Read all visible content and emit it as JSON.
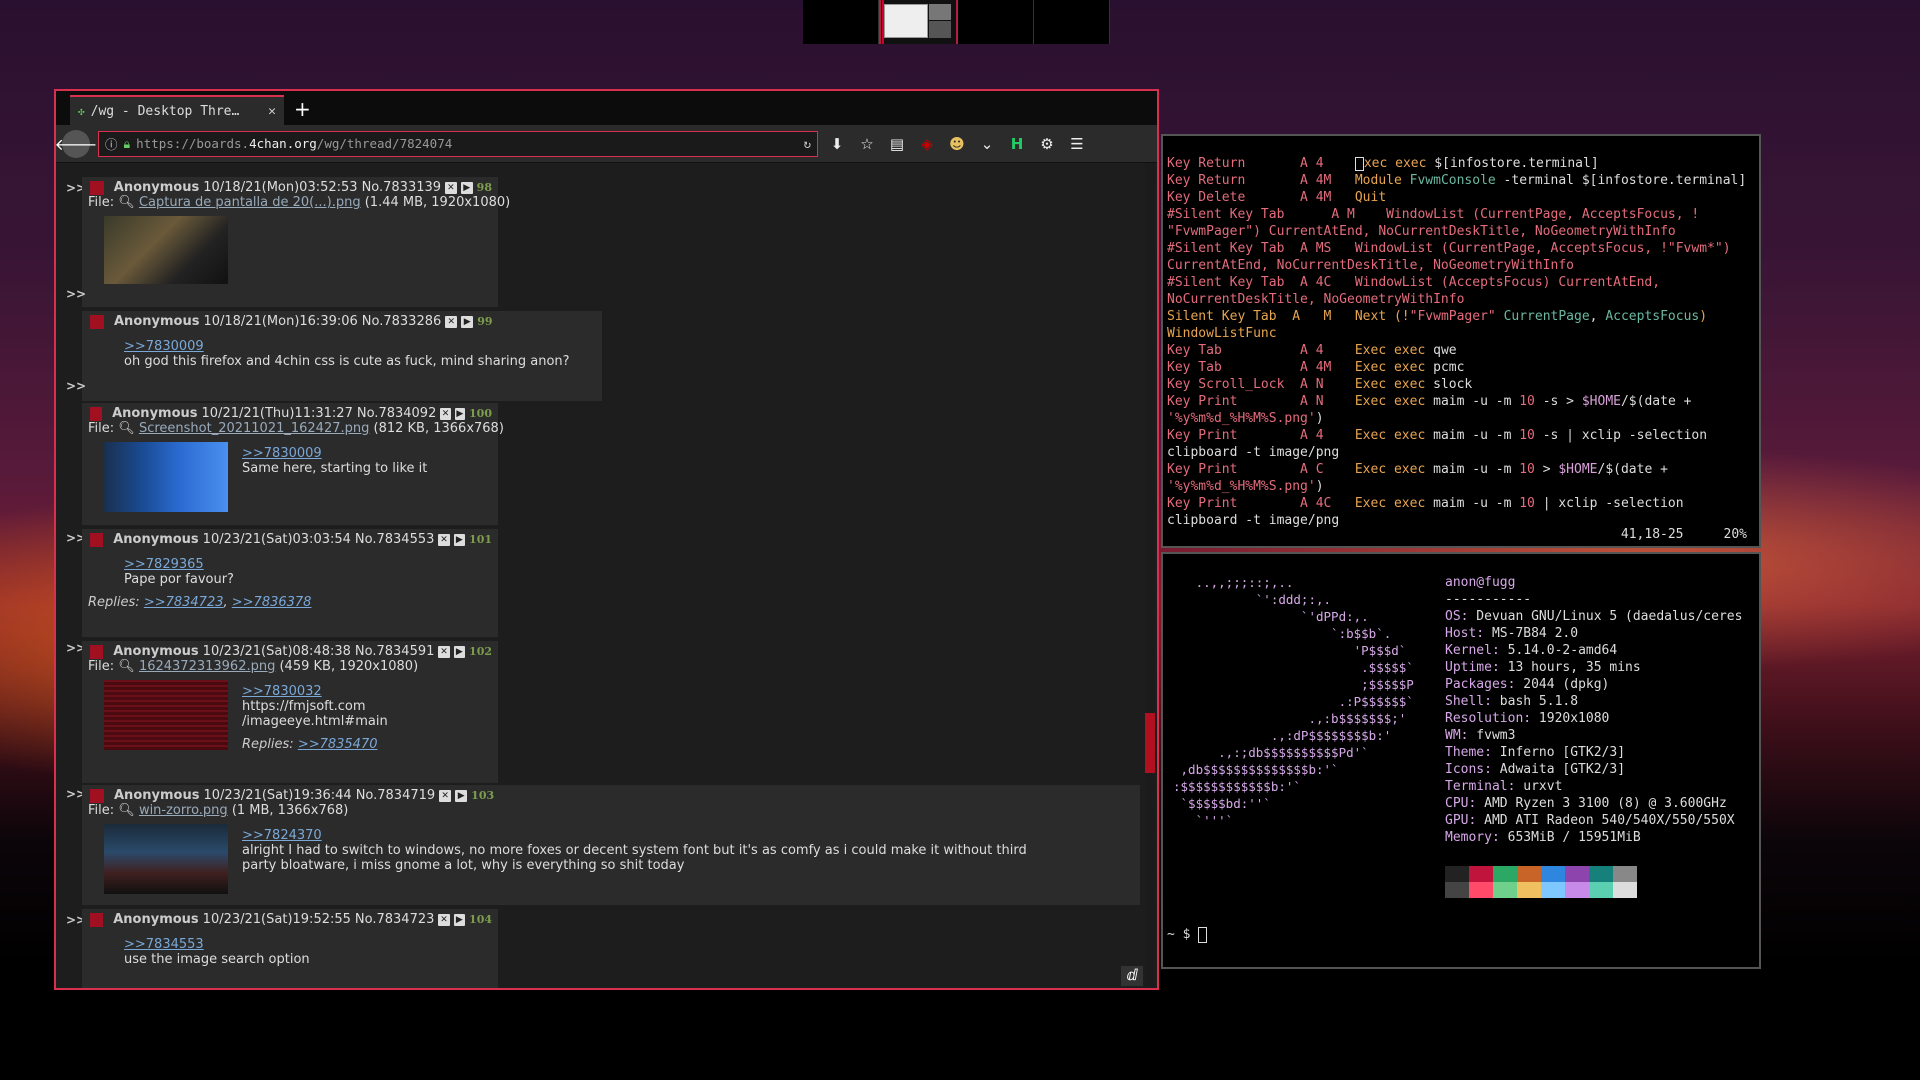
{
  "pager": {
    "desks": 4,
    "active": 1
  },
  "browser": {
    "tab_title": "/wg - Desktop Thre…",
    "url_prefix": "https://boards.",
    "url_host": "4chan.org",
    "url_path": "/wg/thread/7824074",
    "posts": [
      {
        "name": "Anonymous",
        "date": "10/18/21(Mon)03:52:53",
        "no": "No.7833139",
        "reply_num": "98",
        "file_label": "File:",
        "file_name": "Captura de pantalla de 20(...).png",
        "file_info": "(1.44 MB, 1920x1080)",
        "quote": "",
        "text": "",
        "replies": ""
      },
      {
        "name": "Anonymous",
        "date": "10/18/21(Mon)16:39:06",
        "no": "No.7833286",
        "reply_num": "99",
        "file_label": "",
        "file_name": "",
        "file_info": "",
        "quote": ">>7830009",
        "text": "oh god this firefox and 4chin css is cute as fuck, mind sharing anon?",
        "replies": ""
      },
      {
        "name": "Anonymous",
        "date": "10/21/21(Thu)11:31:27",
        "no": "No.7834092",
        "reply_num": "100",
        "file_label": "File:",
        "file_name": "Screenshot_20211021_162427.png",
        "file_info": "(812 KB, 1366x768)",
        "quote": ">>7830009",
        "text": "Same here, starting to like it",
        "replies": ""
      },
      {
        "name": "Anonymous",
        "date": "10/23/21(Sat)03:03:54",
        "no": "No.7834553",
        "reply_num": "101",
        "file_label": "",
        "file_name": "",
        "file_info": "",
        "quote": ">>7829365",
        "text": "Pape por favour?",
        "replies_label": "Replies:",
        "replies_a": ">>7834723",
        "replies_b": ">>7836378"
      },
      {
        "name": "Anonymous",
        "date": "10/23/21(Sat)08:48:38",
        "no": "No.7834591",
        "reply_num": "102",
        "file_label": "File:",
        "file_name": "1624372313962.png",
        "file_info": "(459 KB, 1920x1080)",
        "quote": ">>7830032",
        "text": "https://fmjsoft.com /imageeye.html#main",
        "replies_label": "Replies:",
        "replies_a": ">>7835470"
      },
      {
        "name": "Anonymous",
        "date": "10/23/21(Sat)19:36:44",
        "no": "No.7834719",
        "reply_num": "103",
        "file_label": "File:",
        "file_name": "win-zorro.png",
        "file_info": "(1 MB, 1366x768)",
        "quote": ">>7824370",
        "text": "alright I had to switch to windows, no more foxes or decent system font but it's as comfy as i could make it without third party bloatware, i miss gnome a lot, why is everything so shit today"
      },
      {
        "name": "Anonymous",
        "date": "10/23/21(Sat)19:52:55",
        "no": "No.7834723",
        "reply_num": "104",
        "file_label": "",
        "file_name": "",
        "file_info": "",
        "quote": ">>7834553",
        "text": "use the image search option"
      }
    ],
    "arrows": ">>"
  },
  "editor": {
    "status_pos": "41,18-25",
    "status_pct": "20%"
  },
  "neofetch": {
    "user": "anon@fugg",
    "sep": "-----------",
    "rows": [
      {
        "k": "OS:",
        "v": " Devuan GNU/Linux 5 (daedalus/ceres"
      },
      {
        "k": "Host:",
        "v": " MS-7B84 2.0"
      },
      {
        "k": "Kernel:",
        "v": " 5.14.0-2-amd64"
      },
      {
        "k": "Uptime:",
        "v": " 13 hours, 35 mins"
      },
      {
        "k": "Packages:",
        "v": " 2044 (dpkg)"
      },
      {
        "k": "Shell:",
        "v": " bash 5.1.8"
      },
      {
        "k": "Resolution:",
        "v": " 1920x1080"
      },
      {
        "k": "WM:",
        "v": " fvwm3"
      },
      {
        "k": "Theme:",
        "v": " Inferno [GTK2/3]"
      },
      {
        "k": "Icons:",
        "v": " Adwaita [GTK2/3]"
      },
      {
        "k": "Terminal:",
        "v": " urxvt"
      },
      {
        "k": "CPU:",
        "v": " AMD Ryzen 3 3100 (8) @ 3.600GHz"
      },
      {
        "k": "GPU:",
        "v": " AMD ATI Radeon 540/540X/550/550X"
      },
      {
        "k": "Memory:",
        "v": " 653MiB / 15951MiB"
      }
    ],
    "prompt": "~ $ ",
    "palette": [
      "#222222",
      "#c0143c",
      "#2aa864",
      "#c86428",
      "#2e86de",
      "#8e44ad",
      "#16817a",
      "#888888",
      "#444444",
      "#ff4a6a",
      "#6ed08a",
      "#f0c060",
      "#7ec8ff",
      "#c88ae8",
      "#5ad0b0",
      "#dddddd"
    ]
  },
  "colors": {
    "accent": "#d8304e",
    "postbg": "#2b2b2b",
    "link": "#7aa8d8"
  }
}
